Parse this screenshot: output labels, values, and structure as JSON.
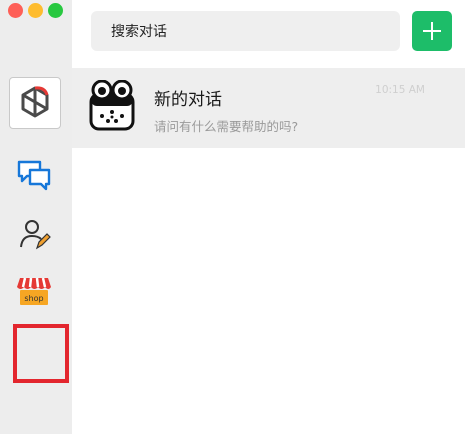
{
  "window": {
    "controls": [
      "close",
      "minimize",
      "zoom"
    ]
  },
  "sidebar": {
    "items": [
      {
        "name": "app-logo",
        "icon": "openai-logo-icon"
      },
      {
        "name": "chats",
        "icon": "chat-bubbles-icon",
        "accent": "#1677d9"
      },
      {
        "name": "contacts",
        "icon": "user-edit-icon"
      },
      {
        "name": "shop",
        "icon": "shop-icon",
        "label": "shop"
      },
      {
        "name": "empty-slot",
        "border_color": "#e3262e"
      }
    ]
  },
  "search": {
    "text": "搜索对话"
  },
  "add_button": {
    "icon": "plus-icon",
    "color": "#1dbd69"
  },
  "conversations": [
    {
      "title": "新的对话",
      "preview": "请问有什么需要帮助的吗?",
      "time": "10:15 AM",
      "avatar_icon": "robot-face-icon"
    }
  ]
}
